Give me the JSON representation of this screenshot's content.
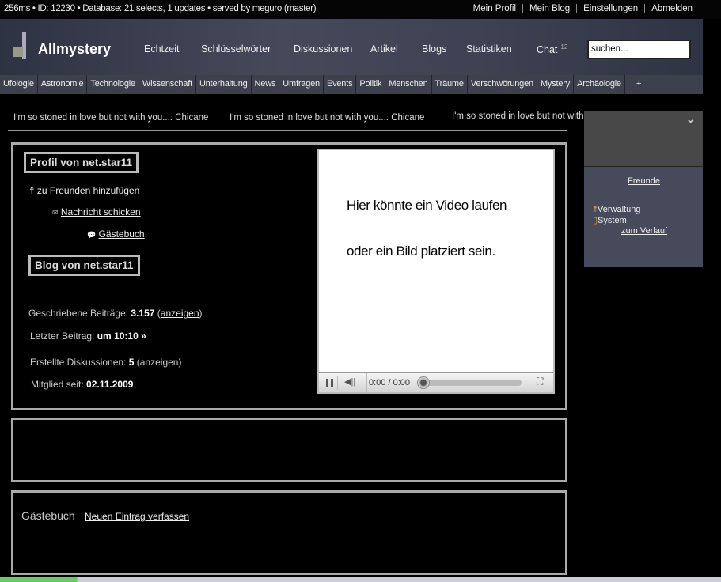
{
  "topbar": {
    "stats": "256ms • ID: 12230 • Database: 21 selects, 1 updates • served by meguro (master)",
    "links": [
      "Mein Profil",
      "Mein Blog",
      "Einstellungen",
      "Abmelden"
    ]
  },
  "header": {
    "logo": "Allmystery",
    "nav": [
      "Echtzeit",
      "Schlüsselwörter",
      "Diskussionen",
      "Artikel",
      "Blogs",
      "Statistiken",
      "Chat"
    ],
    "chat_count": "12",
    "search_value": "suchen..."
  },
  "categories": [
    "Ufologie",
    "Astronomie",
    "Technologie",
    "Wissenschaft",
    "Unterhaltung",
    "News",
    "Umfragen",
    "Events",
    "Politik",
    "Menschen",
    "Träume",
    "Verschwörungen",
    "Mystery",
    "Archäologie",
    "+"
  ],
  "marquee": [
    "I'm so stoned in love but not with you.... Chicane",
    "I'm so stoned in love but not with you.... Chicane",
    "I'm so stoned in love but not with"
  ],
  "profile": {
    "title": "Profil von net.star11",
    "add_friend": "zu Freunden hinzufügen",
    "message": "Nachricht schicken",
    "guestbook": "Gästebuch",
    "blog": "Blog von net.star11",
    "posts_label": "Geschriebene Beiträge:",
    "posts_value": "3.157",
    "show": "anzeigen",
    "last_label": "Letzter Beitrag:",
    "last_value": "um 10:10 »",
    "disc_label": "Erstellte Diskussionen:",
    "disc_value": "5",
    "disc_show": "(anzeigen)",
    "member_label": "Mitglied seit:",
    "member_value": "02.11.2009"
  },
  "video": {
    "line1": "Hier könnte ein Video laufen",
    "line2": "oder ein Bild platziert sein.",
    "time": "0:00 / 0:00",
    "progress": 0
  },
  "guestbook": {
    "title": "Gästebuch",
    "new_entry": "Neuen Eintrag verfassen"
  },
  "sidebar": {
    "friends": "Freunde",
    "admin": "Verwaltung",
    "system": "System",
    "history": "zum Verlauf"
  }
}
